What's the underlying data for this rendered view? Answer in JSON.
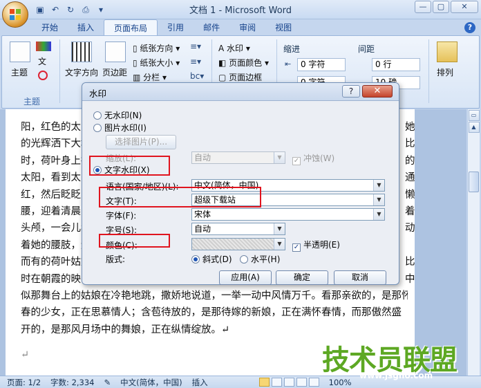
{
  "app": {
    "title": "文档 1 - Microsoft Word"
  },
  "window_buttons": {
    "minimize": "—",
    "restore": "▢",
    "close": "✕"
  },
  "quick_access": [
    "save-icon",
    "undo-icon",
    "redo-icon",
    "print-preview-icon",
    "customize-icon"
  ],
  "tabs": [
    {
      "label": "开始"
    },
    {
      "label": "插入"
    },
    {
      "label": "页面布局"
    },
    {
      "label": "引用"
    },
    {
      "label": "邮件"
    },
    {
      "label": "审阅"
    },
    {
      "label": "视图"
    }
  ],
  "ribbon": {
    "theme_group": {
      "button": "主题",
      "label": "主题"
    },
    "page_setup": {
      "text_direction": "文字方向",
      "margins": "页边距",
      "orientation": "纸张方向",
      "size": "纸张大小",
      "columns": "分栏"
    },
    "page_background": {
      "watermark": "水印",
      "page_color": "页面颜色",
      "page_borders": "页面边框"
    },
    "paragraph": {
      "indent_label": "缩进",
      "spacing_label": "间距",
      "indent_left": "0 字符",
      "indent_right": "0 字符",
      "space_before": "0 行",
      "space_after": "10 磅"
    },
    "arrange": {
      "button": "排列"
    }
  },
  "document": {
    "lines": [
      "阳，红色的太阳",
      "的光辉洒下大地",
      "时，荷叶身上披",
      "太阳，看到太阳",
      "红，然后眨眨眼",
      "腰，迎着清晨的",
      "头颅，一会儿看",
      "着她的腰肢，迎",
      "而有的荷叶姑娘",
      "时在朝霞的映",
      "似那舞台上的姑娘在冷艳地跳，撒娇地说道，一举一动中风情万千。看那亲欲的，是那怀",
      "春的少女，正在思慕情人；含苞待放的，是那待嫁的新娘，正在满怀春情，而那傲然盛",
      "开的，是那风月场中的舞娘，正在纵情绽放。↵"
    ],
    "right_fragments": [
      "她",
      "比",
      "的",
      "通",
      "懒",
      "着",
      "动",
      "",
      "比",
      "中"
    ],
    "empty_para": "↵"
  },
  "dialog": {
    "title": "水印",
    "help_button": "?",
    "close_button": "✕",
    "options": {
      "no_watermark": "无水印(N)",
      "picture_watermark": "图片水印(I)",
      "select_picture": "选择图片(P)...",
      "scale_label": "缩放(L):",
      "scale_value": "自动",
      "washout": "冲蚀(W)",
      "text_watermark": "文字水印(X)"
    },
    "fields": {
      "language_label": "语言(国家/地区)(L):",
      "language_value": "中文(简体，中国)",
      "text_label": "文字(T):",
      "text_value": "超级下载站",
      "font_label": "字体(F):",
      "font_value": "宋体",
      "size_label": "字号(S):",
      "size_value": "自动",
      "color_label": "颜色(C):",
      "color_value": "",
      "semitransparent": "半透明(E)",
      "layout_label": "版式:",
      "diagonal": "斜式(D)",
      "horizontal": "水平(H)"
    },
    "buttons": {
      "apply": "应用(A)",
      "ok": "确定",
      "cancel": "取消"
    }
  },
  "status_bar": {
    "page": "页面: 1/2",
    "words": "字数: 2,334",
    "language": "中文(简体，中国)",
    "mode": "插入",
    "zoom": "100%"
  },
  "watermark_logo": {
    "main": "技术员联盟",
    "url": "www.jsgho.com"
  },
  "colors": {
    "highlight_box": "#e0141e",
    "ribbon_text": "#15428b",
    "logo_green": "#5da823"
  }
}
